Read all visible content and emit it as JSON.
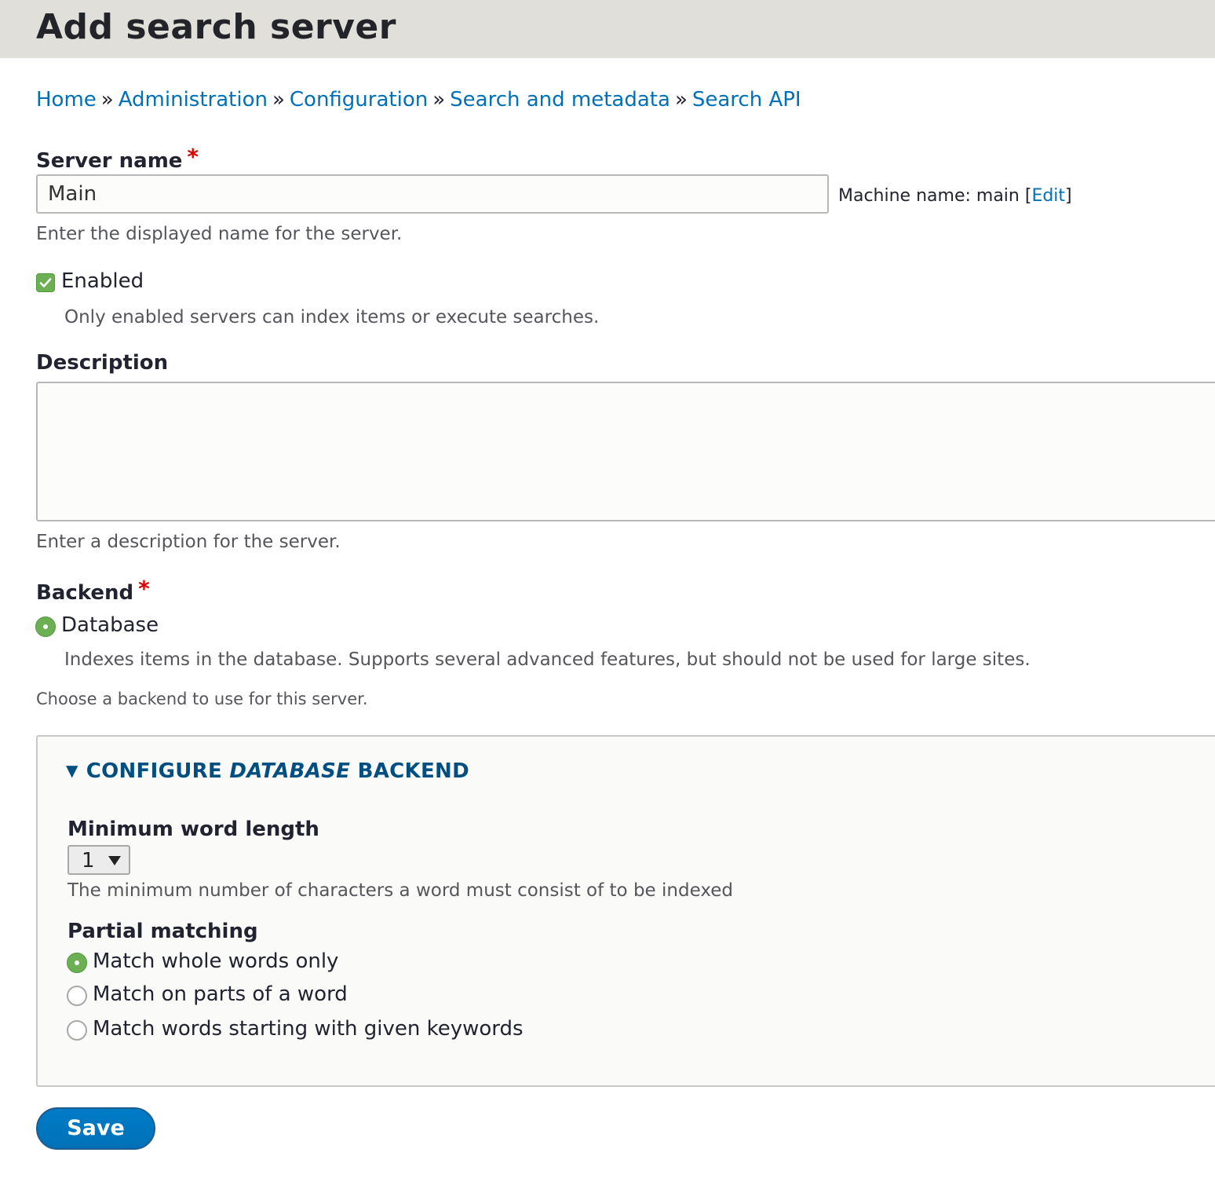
{
  "header": {
    "title": "Add search server"
  },
  "breadcrumb": {
    "items": [
      "Home",
      "Administration",
      "Configuration",
      "Search and metadata",
      "Search API"
    ],
    "separator": "»"
  },
  "server_name": {
    "label": "Server name",
    "required_mark": "*",
    "value": "Main",
    "machine_name_prefix": "Machine name: main [",
    "machine_name_edit": "Edit",
    "machine_name_suffix": "]",
    "description": "Enter the displayed name for the server."
  },
  "enabled": {
    "label": "Enabled",
    "checked": true,
    "description": "Only enabled servers can index items or execute searches."
  },
  "description_field": {
    "label": "Description",
    "value": "",
    "description": "Enter a description for the server."
  },
  "backend": {
    "label": "Backend",
    "required_mark": "*",
    "option_label": "Database",
    "option_description": "Indexes items in the database. Supports several advanced features, but should not be used for large sites.",
    "description": "Choose a backend to use for this server."
  },
  "configure": {
    "summary_prefix": "CONFIGURE ",
    "summary_emphasis": "DATABASE",
    "summary_suffix": " BACKEND",
    "min_word_length": {
      "label": "Minimum word length",
      "value": "1",
      "description": "The minimum number of characters a word must consist of to be indexed"
    },
    "partial_matching": {
      "label": "Partial matching",
      "options": [
        "Match whole words only",
        "Match on parts of a word",
        "Match words starting with given keywords"
      ],
      "selected": 0
    }
  },
  "actions": {
    "save_label": "Save"
  },
  "colors": {
    "accent": "#0071b8",
    "checked": "#6cb053",
    "required": "#e00000",
    "header_bg": "#e0dfd9"
  }
}
